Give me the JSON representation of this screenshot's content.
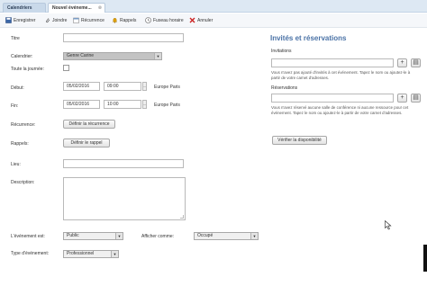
{
  "tabs": [
    {
      "label": "Calendriers"
    },
    {
      "label": "Nouvel événeme...",
      "close": "⊗"
    }
  ],
  "toolbar": {
    "save": "Enregistrer",
    "attach": "Joindre",
    "recurrence": "Récurrence",
    "reminders": "Rappels",
    "timezone": "Fuseau horaire",
    "cancel": "Annuler"
  },
  "form": {
    "title_label": "Titre",
    "title_value": "",
    "calendar_label": "Calendrier:",
    "calendar_value": "Genre Carine",
    "allday_label": "Toute la journée:",
    "start_label": "Début:",
    "start_date": "05/02/2016",
    "start_time": "09:00",
    "start_tz": "Europe Paris",
    "end_label": "Fin:",
    "end_date": "05/02/2016",
    "end_time": "10:00",
    "end_tz": "Europe Paris",
    "recurrence_label": "Récurrence:",
    "recurrence_button": "Définir la récurrence",
    "reminders_label": "Rappels:",
    "reminders_button": "Définir le rappel",
    "location_label": "Lieu:",
    "description_label": "Description:",
    "event_is_label": "L'événement est:",
    "event_is_value": "Public",
    "display_as_label": "Afficher comme:",
    "display_as_value": "Occupé",
    "event_type_label": "Type d'événement:",
    "event_type_value": "Professionnel"
  },
  "right": {
    "title": "Invités et réservations",
    "invitations_label": "Invitations",
    "invitations_help": "Vous n'avez pas ajouté d'invités à cet événement. Tapez le nom ou ajoutez-le à partir de votre carnet d'adresses.",
    "reservations_label": "Réservations",
    "reservations_help": "Vous n'avez réservé aucune salle de conférence ni aucune ressource pour cet événement. Tapez le nom ou ajoutez-le à partir de votre carnet d'adresses.",
    "check_button": "Vérifier la disponibilité",
    "add_symbol": "+",
    "book_symbol": "▤"
  },
  "colors": {
    "accent": "#4a72a6",
    "tabbar": "#dde8f3",
    "cancel": "#cc2222",
    "reminder": "#e0a000"
  }
}
